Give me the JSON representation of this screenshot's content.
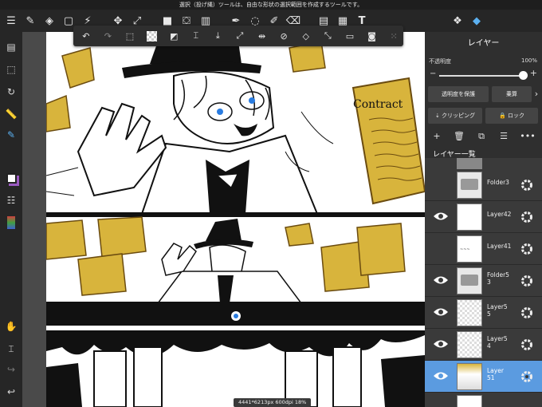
{
  "status_text": "選択（投げ縄）ツールは、自由な形状の選択範囲を作成するツールです。",
  "toolbar": {
    "icons": [
      "menu-icon",
      "brush-icon",
      "eraser-icon",
      "rect-select-icon",
      "magic-wand-icon",
      "move-icon",
      "transform-icon",
      "fill-color-icon",
      "bucket-icon",
      "gradient-icon",
      "pen-icon",
      "lasso-icon",
      "selection-pen-icon",
      "select-clear-icon",
      "frame-icon",
      "text-icon",
      "materials-icon",
      "layers-icon"
    ]
  },
  "command_bar": {
    "icons": [
      "undo-icon",
      "redo-icon",
      "deselect-icon",
      "transparent-icon",
      "invert-icon",
      "eyedropper-icon",
      "fill-selection-icon",
      "transform-selection-icon",
      "flip-icon",
      "clear-icon",
      "erase-selection-icon",
      "expand-icon",
      "crop-icon",
      "color-block-icon",
      "grid-icon"
    ]
  },
  "canvas": {
    "info": "4441*6213px 600dpi 18%",
    "contract_text": "Contract"
  },
  "layer_panel": {
    "title": "レイヤー",
    "opacity_label": "不透明度",
    "opacity_value": "100%",
    "opacity_fraction": 0.92,
    "protect_alpha": "透明度を保護",
    "blend_mode": "乗算",
    "clipping": "クリッピング",
    "lock": "ロック",
    "list_title": "レイヤー一覧",
    "layers": [
      {
        "name": "Folder3",
        "visible": false,
        "type": "folder"
      },
      {
        "name": "Layer42",
        "visible": true,
        "type": "layer"
      },
      {
        "name": "Layer41",
        "visible": false,
        "type": "layer"
      },
      {
        "name": "Folder5\n3",
        "visible": true,
        "type": "folder"
      },
      {
        "name": "Layer5\n5",
        "visible": true,
        "type": "layer"
      },
      {
        "name": "Layer5\n4",
        "visible": true,
        "type": "layer"
      },
      {
        "name": "Layer\n51",
        "visible": true,
        "type": "layer",
        "selected": true
      }
    ]
  }
}
